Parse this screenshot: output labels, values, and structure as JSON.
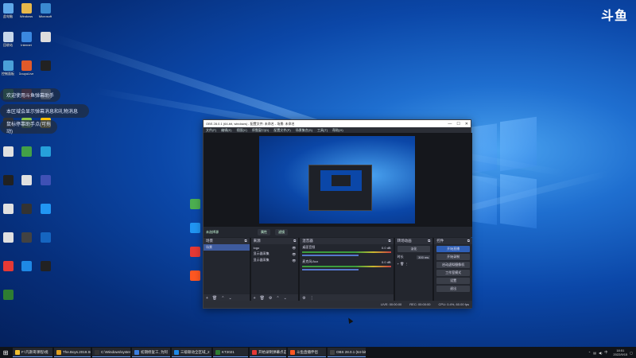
{
  "watermark": {
    "logo_text": "斗鱼"
  },
  "notifications": [
    {
      "text": "欢迎使用斗鱼弹幕助手"
    },
    {
      "text": "本区域会显示弹幕消息和礼物消息"
    },
    {
      "text": "鼠标停靠助手点(可拖动)"
    }
  ],
  "desktop_icons": [
    {
      "label": "此电脑",
      "color": "#5fa8e8"
    },
    {
      "label": "Windows",
      "color": "#e8b84a"
    },
    {
      "label": "Microsoft",
      "color": "#3a8ad0"
    },
    {
      "label": "回收站",
      "color": "#c7d7ea"
    },
    {
      "label": "Internet",
      "color": "#3b88e0"
    },
    {
      "label": "",
      "color": "#dddddd"
    },
    {
      "label": "控制面板",
      "color": "#4aa0d8"
    },
    {
      "label": "DouyuLive",
      "color": "#e25a2a"
    },
    {
      "label": "",
      "color": "#222222"
    },
    {
      "label": "",
      "color": "#4caf50"
    },
    {
      "label": "",
      "color": "#c94040"
    },
    {
      "label": "",
      "color": "#f2f2f2"
    },
    {
      "label": "",
      "color": "#333333"
    },
    {
      "label": "",
      "color": "#8bc34a"
    },
    {
      "label": "",
      "color": "#ffc107"
    },
    {
      "label": "",
      "color": "#e0e0e0"
    },
    {
      "label": "",
      "color": "#43a047"
    },
    {
      "label": "",
      "color": "#26a0da"
    },
    {
      "label": "",
      "color": "#212121"
    },
    {
      "label": "",
      "color": "#e0e0e0"
    },
    {
      "label": "",
      "color": "#3f51b5"
    },
    {
      "label": "",
      "color": "#e0e0e0"
    },
    {
      "label": "",
      "color": "#333333"
    },
    {
      "label": "",
      "color": "#2196f3"
    },
    {
      "label": "",
      "color": "#e0e0e0"
    },
    {
      "label": "",
      "color": "#424242"
    },
    {
      "label": "",
      "color": "#1565c0"
    },
    {
      "label": "",
      "color": "#e53935"
    },
    {
      "label": "",
      "color": "#1e88e5"
    },
    {
      "label": "",
      "color": "#222222"
    },
    {
      "label": "",
      "color": "#2e7d32"
    }
  ],
  "right_icons": [
    {
      "label": "",
      "color": "#4caf50"
    },
    {
      "label": "",
      "color": "#2196f3"
    },
    {
      "label": "",
      "color": "#e53935"
    },
    {
      "label": "",
      "color": "#ff5722"
    }
  ],
  "obs": {
    "title": "OBS 28.0.1 (64-bit, windows) - 配置文件: 未命名 - 场景: 未命名",
    "menu": [
      "文件(F)",
      "编辑(E)",
      "视图(V)",
      "停靠窗口(D)",
      "配置文件(P)",
      "场景集合(S)",
      "工具(T)",
      "帮助(H)"
    ],
    "source_bar_label": "未选择源",
    "source_bar_buttons": [
      "属性",
      "滤镜"
    ],
    "docks": {
      "scenes": {
        "title": "场景",
        "items": [
          "场景"
        ]
      },
      "sources": {
        "title": "来源",
        "items": [
          "logo",
          "显示器采集",
          "显示器采集"
        ]
      },
      "mixer": {
        "title": "混音器",
        "channels": [
          {
            "name": "桌面音频",
            "db": "0.0 dB"
          },
          {
            "name": "麦克风/Aux",
            "db": "0.0 dB"
          }
        ]
      },
      "transitions": {
        "title": "转场动画",
        "type": "淡化",
        "duration_label": "时长",
        "duration": "300 ms"
      },
      "controls": {
        "title": "控件",
        "buttons": [
          "开始直播",
          "开始录制",
          "启动虚拟摄像机",
          "工作室模式",
          "设置",
          "退出"
        ]
      }
    },
    "status": {
      "live": "LIVE: 00:00:00",
      "rec": "REC: 00:00:00",
      "cpu": "CPU: 0.4%, 60.00 fps"
    }
  },
  "taskbar": {
    "items": [
      {
        "label": "F:\\凡斯哥课程\\视",
        "color": "#f0c030"
      },
      {
        "label": "The.Boys.2019.S0",
        "color": "#e0a020"
      },
      {
        "label": "C:\\Windows\\system",
        "color": "#333333"
      },
      {
        "label": "初期修复工, 为阿",
        "color": "#3b7ddd"
      },
      {
        "label": "三级联动全区域_2",
        "color": "#1e88e5"
      },
      {
        "label": "KT2021",
        "color": "#2e7d32"
      },
      {
        "label": "开始录制弹幕点击",
        "color": "#e53935"
      },
      {
        "label": "斗鱼直播伴侣",
        "color": "#ff5722"
      },
      {
        "label": "OBS 28.0.1 (64-bit",
        "color": "#444444"
      }
    ],
    "tray_icons": [
      "up-arrow-icon",
      "network-icon",
      "volume-icon",
      "ime-icon"
    ],
    "ime": "中",
    "time": "18:51",
    "date": "2022/9/15"
  }
}
